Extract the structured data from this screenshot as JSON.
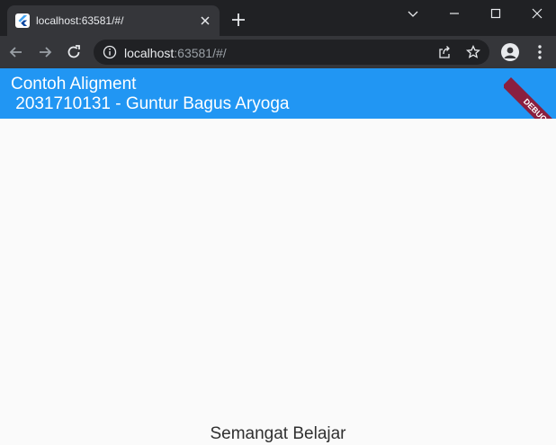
{
  "browser": {
    "tab": {
      "title": "localhost:63581/#/",
      "favicon": "flutter-icon"
    },
    "address_bar": {
      "host": "localhost",
      "rest": ":63581/#/"
    },
    "icons": [
      "back-arrow-icon",
      "forward-arrow-icon",
      "reload-icon",
      "info-icon",
      "share-icon",
      "star-icon",
      "profile-icon",
      "menu-dots-icon"
    ]
  },
  "app": {
    "appbar_title": "Contoh Aligment\n 2031710131 - Guntur Bagus Aryoga",
    "appbar_color": "#2196f3",
    "debug_banner": "DEBUG",
    "body_text": "Semangat Belajar"
  }
}
